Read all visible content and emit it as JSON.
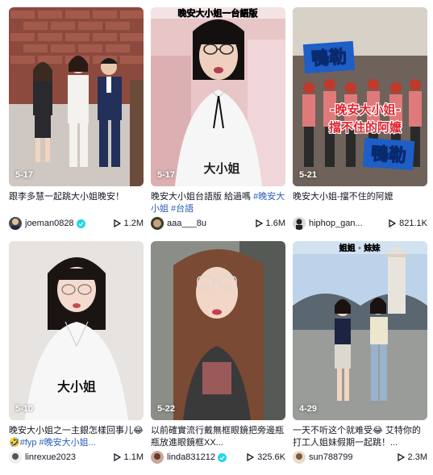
{
  "accent": "#20d5ec",
  "hashtag_color": "#2b5db9",
  "videos": [
    {
      "date": "5-17",
      "caption": "跟李多慧一起跳大小姐晚安！",
      "tags": "",
      "user": "joeman0828",
      "verified": true,
      "views": "1.2M",
      "overlay_text": ""
    },
    {
      "date": "5-17",
      "caption": "晚安大小姐台語版 給過嗎 ",
      "tags": "#晚安大小姐 #台語",
      "user": "aaa___8u",
      "verified": false,
      "views": "1.6M",
      "overlay_text": "大小姐",
      "top_text": "晚安大小姐一台語版"
    },
    {
      "date": "5-21",
      "caption": "晚安大小姐-擋不住的阿嬤",
      "tags": "",
      "user": "hiphop_gan...",
      "verified": false,
      "views": "821.1K",
      "overlay_text": "-晚安大小姐-",
      "overlay_text2": "擋不住的阿嬤",
      "badge_text": "鴨勒",
      "badge_text2": "鴨勒"
    },
    {
      "date": "5-10",
      "caption": "晚安大小姐之一主銀怎樣回事儿😂🤣",
      "tags": "#fyp #晚安大小姐...",
      "user": "linrexue2023",
      "verified": false,
      "views": "1.1M",
      "overlay_text": "大小姐"
    },
    {
      "date": "5-22",
      "caption": "以前確實流行戴無框眼鏡把旁邊瓶瓶放進眼鏡框XX...",
      "tags": "",
      "user": "linda831212",
      "verified": true,
      "views": "325.6K",
      "overlay_text": ""
    },
    {
      "date": "4-29",
      "caption": "一天不听这个就难受😂 艾特你的打工人姐妹假期一起跳！...",
      "tags": "",
      "user": "sun788799",
      "verified": false,
      "views": "2.3M",
      "overlay_text": "",
      "top_text": "姐姐 · 妹妹"
    }
  ]
}
